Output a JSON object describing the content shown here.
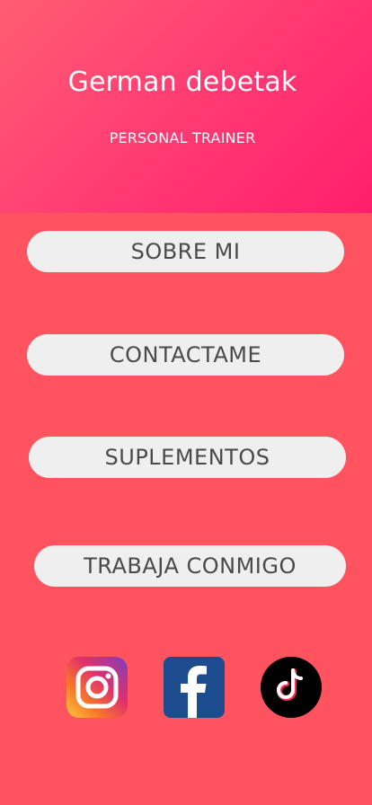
{
  "header": {
    "title": "German debetak",
    "subtitle": "PERSONAL TRAINER"
  },
  "menu": {
    "buttons": [
      {
        "label": "SOBRE MI"
      },
      {
        "label": "CONTACTAME"
      },
      {
        "label": "SUPLEMENTOS"
      },
      {
        "label": "TRABAJA CONMIGO"
      }
    ]
  },
  "social": {
    "icons": [
      "instagram-icon",
      "facebook-icon",
      "tiktok-icon"
    ]
  },
  "colors": {
    "background": "#ff5460",
    "header_gradient_start": "#ff5d72",
    "header_gradient_end": "#ff1e6c",
    "button_bg": "#efefef",
    "button_text": "#4a4a4a",
    "facebook_blue": "#1d4c8e"
  }
}
